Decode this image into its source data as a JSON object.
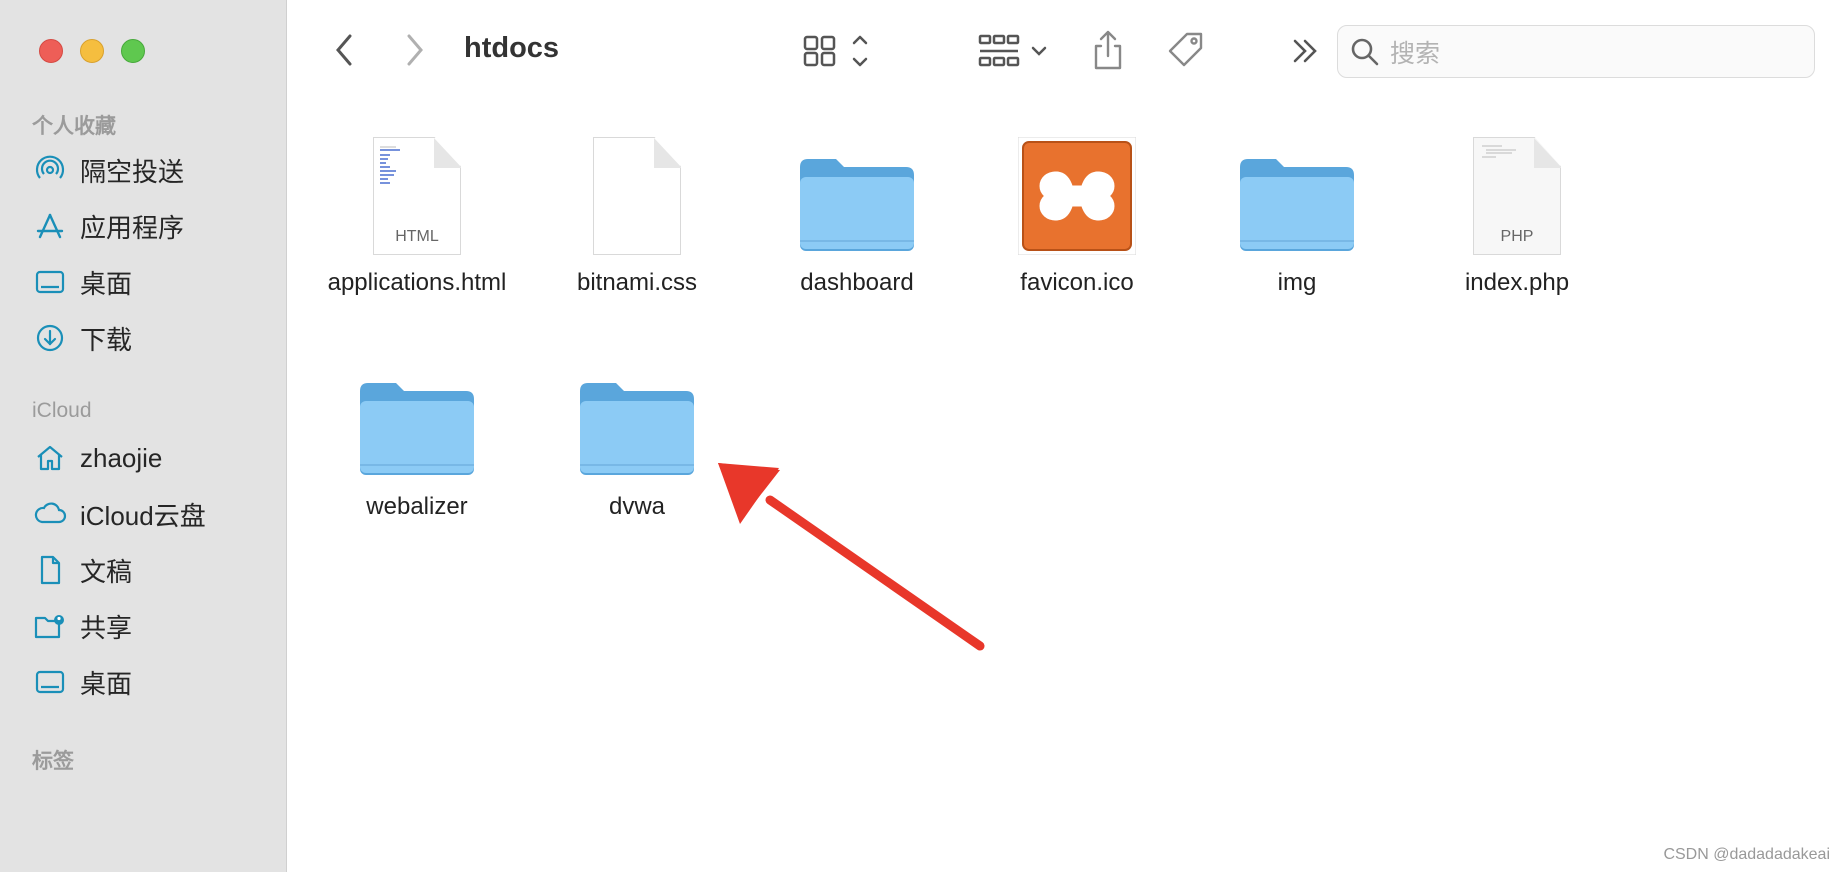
{
  "window": {
    "title": "htdocs"
  },
  "sidebar": {
    "favorites_title": "个人收藏",
    "favorites": [
      {
        "label": "隔空投送",
        "icon": "airdrop-icon"
      },
      {
        "label": "应用程序",
        "icon": "applications-icon"
      },
      {
        "label": "桌面",
        "icon": "desktop-icon"
      },
      {
        "label": "下载",
        "icon": "downloads-icon"
      }
    ],
    "icloud_title": "iCloud",
    "icloud": [
      {
        "label": "zhaojie",
        "icon": "home-icon"
      },
      {
        "label": "iCloud云盘",
        "icon": "icloud-drive-icon"
      },
      {
        "label": "文稿",
        "icon": "document-icon"
      },
      {
        "label": "共享",
        "icon": "shared-folder-icon"
      },
      {
        "label": "桌面",
        "icon": "desktop-icon"
      }
    ],
    "tags_title": "标签"
  },
  "search": {
    "placeholder": "搜索"
  },
  "files": [
    {
      "name": "applications.html",
      "type": "html",
      "badge": "HTML"
    },
    {
      "name": "bitnami.css",
      "type": "blank"
    },
    {
      "name": "dashboard",
      "type": "folder"
    },
    {
      "name": "favicon.ico",
      "type": "xampp"
    },
    {
      "name": "img",
      "type": "folder"
    },
    {
      "name": "index.php",
      "type": "php",
      "badge": "PHP"
    },
    {
      "name": "webalizer",
      "type": "folder"
    },
    {
      "name": "dvwa",
      "type": "folder"
    }
  ],
  "watermark": "CSDN @dadadadakeai",
  "colors": {
    "accent": "#1a8fb8",
    "folder": "#88c9f5",
    "arrow": "#e8372a"
  }
}
